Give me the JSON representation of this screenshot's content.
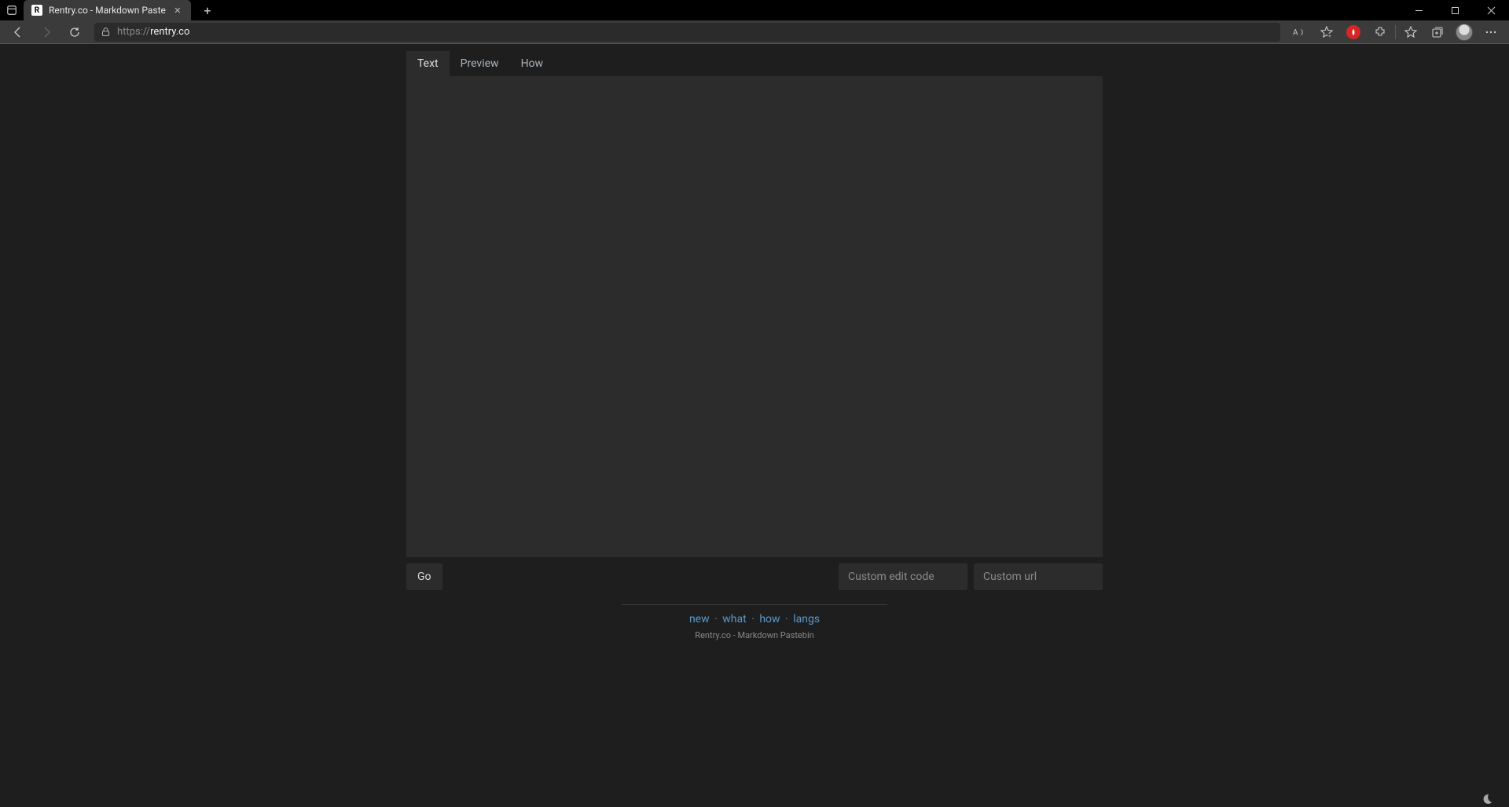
{
  "browser": {
    "tab_title": "Rentry.co - Markdown Paste",
    "url_proto": "https://",
    "url_host": "rentry.co"
  },
  "page": {
    "tabs": {
      "text": "Text",
      "preview": "Preview",
      "how": "How"
    },
    "go_label": "Go",
    "edit_code_placeholder": "Custom edit code",
    "custom_url_placeholder": "Custom url",
    "footer_links": {
      "new": "new",
      "what": "what",
      "how": "how",
      "langs": "langs"
    },
    "footer_sub": "Rentry.co - Markdown Pastebin"
  }
}
